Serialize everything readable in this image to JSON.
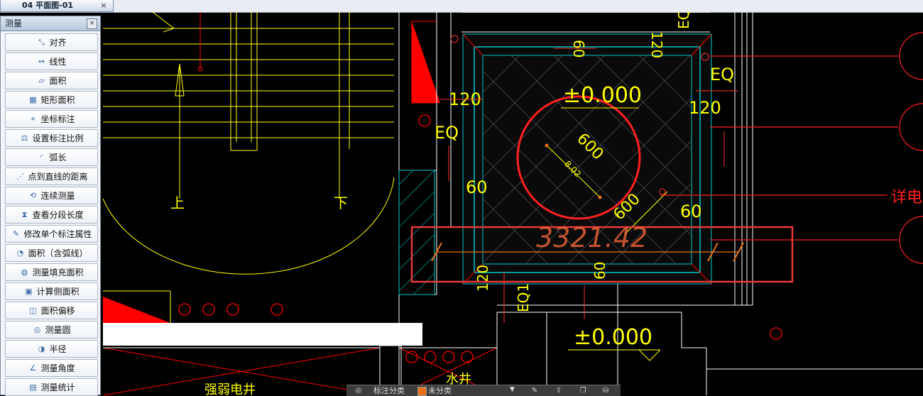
{
  "tab": {
    "title": "04 平面图-01",
    "close": "×"
  },
  "panel": {
    "title": "测量",
    "close": "×",
    "items": [
      {
        "label": "对齐",
        "icon": "align-measure-icon"
      },
      {
        "label": "线性",
        "icon": "linear-measure-icon"
      },
      {
        "label": "面积",
        "icon": "area-icon"
      },
      {
        "label": "矩形面积",
        "icon": "rect-area-icon"
      },
      {
        "label": "坐标标注",
        "icon": "coordinate-icon"
      },
      {
        "label": "设置标注比例",
        "icon": "scale-icon"
      },
      {
        "label": "弧长",
        "icon": "arc-length-icon"
      },
      {
        "label": "点到直线的距离",
        "icon": "point-line-distance-icon"
      },
      {
        "label": "连续测量",
        "icon": "continuous-measure-icon"
      },
      {
        "label": "查看分段长度",
        "icon": "segment-length-icon"
      },
      {
        "label": "修改单个标注属性",
        "icon": "edit-annotation-icon"
      },
      {
        "label": "面积（含弧线）",
        "icon": "arc-area-icon"
      },
      {
        "label": "测量填充面积",
        "icon": "fill-area-icon"
      },
      {
        "label": "计算侧面积",
        "icon": "side-area-icon"
      },
      {
        "label": "面积偏移",
        "icon": "area-offset-icon"
      },
      {
        "label": "测量圆",
        "icon": "circle-measure-icon"
      },
      {
        "label": "半径",
        "icon": "radius-icon"
      },
      {
        "label": "测量角度",
        "icon": "angle-icon"
      },
      {
        "label": "测量统计",
        "icon": "statistics-icon"
      }
    ]
  },
  "drawing": {
    "level_main": "±0.000",
    "level_lower": "±0.000",
    "circle_diameter": "600",
    "circle_radius": "8.02",
    "dim_600_diag": "600",
    "dim_120_top": "120",
    "dim_120_left": "120",
    "dim_120_right": "120",
    "dim_120_bottom": "120",
    "dim_60_top": "60",
    "dim_60_left": "60",
    "dim_60_right": "60",
    "dim_60_bottom": "60",
    "eq_left": "EQ",
    "eq_right": "EQ",
    "eq_top": "EQ",
    "eq_bottom": "EQ1",
    "measure_value": "3321.42",
    "stair_up": "上",
    "stair_down": "下",
    "shaft_label": "强弱电井",
    "water_label": "水井",
    "detail_label": "详电"
  },
  "statusbar": {
    "label": "标注分类",
    "value": "未分类"
  },
  "colors": {
    "yellow": "#ffff00",
    "red": "#ff0000",
    "cyan": "#00c8c8",
    "orange": "#e8731a",
    "white": "#ffffff"
  }
}
